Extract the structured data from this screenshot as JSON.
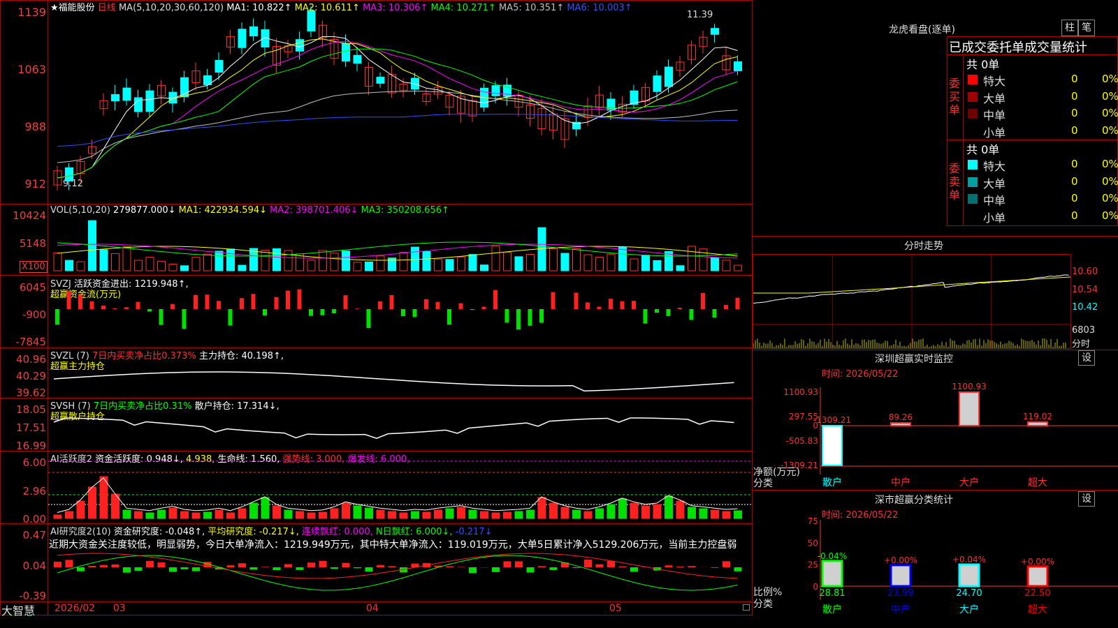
{
  "stock": {
    "name": "★福能股份",
    "period": "日线",
    "ma_label": "MA(5,10,20,30,60,120)",
    "ma": [
      {
        "label": "MA1: 10.822↑",
        "color": "#ffffff"
      },
      {
        "label": "MA2: 10.611↑",
        "color": "#ffff00"
      },
      {
        "label": "MA3: 10.306↑",
        "color": "#ff00ff"
      },
      {
        "label": "MA4: 10.271↑",
        "color": "#00ff00"
      },
      {
        "label": "MA5: 10.351↑",
        "color": "#c0c0c0"
      },
      {
        "label": "MA6: 10.003↑",
        "color": "#0000ff"
      }
    ],
    "price_axis": [
      "1139",
      "1063",
      "988",
      "912"
    ],
    "high_mark": "11.39",
    "low_mark": "9.12"
  },
  "volume": {
    "label": "VOL(5,10,20)",
    "value": "279877.000↓",
    "ma1": "MA1: 422934.594↓",
    "ma2": "MA2: 398701.406↓",
    "ma3": "MA3: 350208.656↑",
    "axis": [
      "10424",
      "5148"
    ],
    "unit": "X100"
  },
  "svzj": {
    "label": "SVZJ",
    "line1": "活跃资金进出: 1219.948↑,",
    "line2": "超赢资金流(万元)",
    "axis": [
      "6045",
      "-900",
      "-7845"
    ]
  },
  "svzl": {
    "label": "SVZL (7)",
    "text1": "7日内买卖净占比0.373%",
    "text2": "主力持仓: 40.198↑,",
    "line2": "超赢主力持仓",
    "axis": [
      "40.96",
      "40.29",
      "39.62"
    ]
  },
  "svsh": {
    "label": "SVSH (7)",
    "text1": "7日内买卖净占比0.31%",
    "text2": "散户持仓: 17.314↓,",
    "line2": "超赢散户持仓",
    "axis": [
      "18.05",
      "17.51",
      "16.99"
    ]
  },
  "ai_act": {
    "label": "AI活跃度2",
    "text1": "资金活跃度: 0.948↓,",
    "text2": "4.938,",
    "text3": "生命线: 1.560,",
    "text4": "强势线: 3.000,",
    "text5": "爆发线: 6.000,",
    "axis": [
      "6.00",
      "2.96",
      "0.00"
    ]
  },
  "ai_res": {
    "label": "AI研究度2(10)",
    "text1": "资金研究度: -0.048↑,",
    "text2": "平均研究度: -0.217↓,",
    "text3": "连续飘红: 0.000,",
    "text4": "N日飘红: 6.000↓,",
    "text5": "-0.217↓",
    "comment": "近期大资金关注度较低，明显弱势，今日大单净流入：1219.949万元，其中特大单净流入：119.019万元，大单5日累计净入5129.206万元，当前主力控盘弱",
    "axis": [
      "0.47",
      "0.04",
      "-0.39"
    ]
  },
  "bottom": {
    "brand": "大智慧",
    "dates": [
      "2026/02",
      "03",
      "04",
      "05"
    ]
  },
  "right": {
    "lhb_title": "龙虎看盘(逐单)",
    "btn_zhu": "柱",
    "btn_bi": "笔",
    "tabs_line": "已成交委托单成交量统计",
    "buy": {
      "side": "委买单",
      "total": "共 0单",
      "rows": [
        {
          "name": "特大",
          "val": "0",
          "pct": "0%",
          "color": "#ff0000"
        },
        {
          "name": "大单",
          "val": "0",
          "pct": "0%",
          "color": "#a00000"
        },
        {
          "name": "中单",
          "val": "0",
          "pct": "0%",
          "color": "#700000"
        },
        {
          "name": "小单",
          "val": "0",
          "pct": "0%",
          "color": ""
        }
      ]
    },
    "sell": {
      "side": "委卖单",
      "total": "共 0单",
      "rows": [
        {
          "name": "特大",
          "val": "0",
          "pct": "0%",
          "color": "#00ffff"
        },
        {
          "name": "大单",
          "val": "0",
          "pct": "0%",
          "color": "#00a0a0"
        },
        {
          "name": "中单",
          "val": "0",
          "pct": "0%",
          "color": "#007070"
        },
        {
          "name": "小单",
          "val": "0",
          "pct": "0%",
          "color": ""
        }
      ]
    },
    "fenshi": {
      "title": "分时走势",
      "axis": [
        "10.60",
        "10.54",
        "10.42"
      ],
      "vol_axis": "6803",
      "vol_label": "分时"
    },
    "monitor": {
      "title": "深圳超赢实时监控",
      "btn": "设",
      "time": "时间: 2026/05/22",
      "yaxis": [
        "1100.93",
        "297.55",
        "0",
        "-505.83",
        "-1309.21"
      ],
      "unit": "净额(万元)",
      "cat_label": "分类",
      "categories": [
        "散户",
        "中户",
        "大户",
        "超大"
      ],
      "values": [
        -1309.21,
        89.26,
        1100.93,
        119.02
      ],
      "value_labels": [
        "-1309.21",
        "89.26",
        "1100.93",
        "119.02"
      ],
      "cat_colors": [
        "#00ffff",
        "#ff3030",
        "#ff3030",
        "#ff3030"
      ]
    },
    "classstat": {
      "title": "深市超赢分类统计",
      "btn": "设",
      "time": "时间: 2026/05/22",
      "yaxis": [
        "75",
        "50",
        "25",
        "0"
      ],
      "unit": "比例%",
      "cat_label": "分类",
      "categories": [
        "散户",
        "中户",
        "大户",
        "超大"
      ],
      "values": [
        28.81,
        23.99,
        24.7,
        22.5
      ],
      "value_labels": [
        "28.81",
        "23.99",
        "24.70",
        "22.50"
      ],
      "change_labels": [
        "-0.04%",
        "+0.00%",
        "+0.04%",
        "+0.00%"
      ],
      "bar_colors": [
        "#00ff00",
        "#0000ff",
        "#00ffff",
        "#ff0000"
      ],
      "cat_colors": [
        "#00ff00",
        "#0000ff",
        "#00ffff",
        "#ff0000"
      ]
    }
  }
}
